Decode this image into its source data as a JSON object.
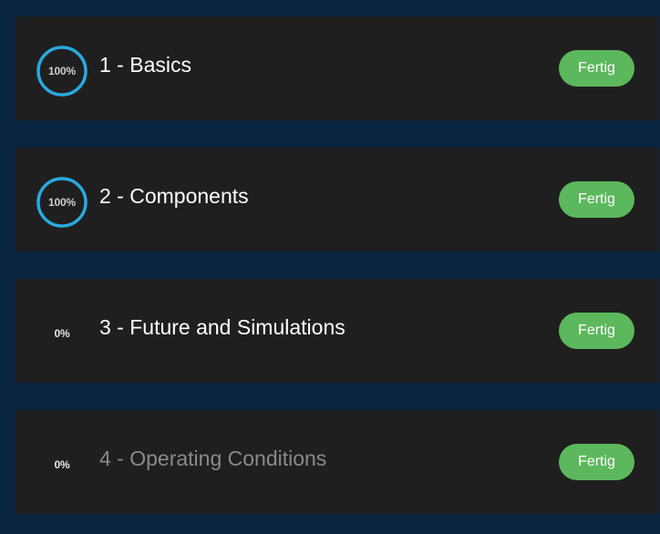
{
  "modules": [
    {
      "progress": "100%",
      "progress_value": 1.0,
      "title": "1 - Basics",
      "status": "Fertig",
      "enabled": true
    },
    {
      "progress": "100%",
      "progress_value": 1.0,
      "title": "2 - Components",
      "status": "Fertig",
      "enabled": true
    },
    {
      "progress": "0%",
      "progress_value": 0.0,
      "title": "3 - Future and Simulations",
      "status": "Fertig",
      "enabled": true
    },
    {
      "progress": "0%",
      "progress_value": 0.0,
      "title": "4 - Operating Conditions",
      "status": "Fertig",
      "enabled": false
    }
  ],
  "colors": {
    "background": "#0b2440",
    "card": "#1f1f1f",
    "progress_ring": "#29a9e0",
    "badge": "#5cb85c",
    "title": "#ffffff",
    "title_disabled": "#8a8a8a"
  }
}
